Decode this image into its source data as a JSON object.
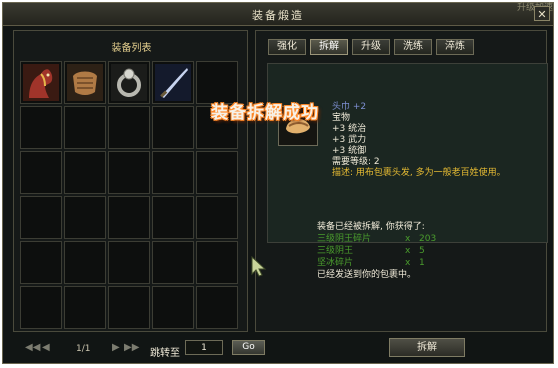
{
  "window": {
    "title": "装备煅造",
    "corner_text": "升级加速",
    "close_label": "✕"
  },
  "left_panel": {
    "header": "装备列表"
  },
  "inventory": [
    {
      "icon": "horse-icon"
    },
    {
      "icon": "armor-icon"
    },
    {
      "icon": "ring-icon"
    },
    {
      "icon": "saber-icon"
    }
  ],
  "tabs": [
    {
      "label": "强化",
      "active": false
    },
    {
      "label": "拆解",
      "active": true
    },
    {
      "label": "升级",
      "active": false
    },
    {
      "label": "洗练",
      "active": false
    },
    {
      "label": "淬炼",
      "active": false
    }
  ],
  "item_info": {
    "name": "头巾 +2",
    "type": "宝物",
    "stat1": "+3 统治",
    "stat2": "+3 武力",
    "stat3": "+3 统御",
    "level_req": "需要等级: 2",
    "description": "描述: 用布包裹头发, 多为一般老百姓使用。"
  },
  "banner": "装备拆解成功",
  "result": {
    "header": "装备已经被拆解, 你获得了:",
    "items": [
      {
        "name": "三级阴王碎片",
        "qty": "203"
      },
      {
        "name": "三级阴王",
        "qty": "5"
      },
      {
        "name": "坚冰碎片",
        "qty": "1"
      }
    ],
    "footer": "已经发送到你的包裹中。"
  },
  "pagination": {
    "first": "◀◀",
    "prev": "◀",
    "page": "1/1",
    "next": "▶",
    "last": "▶▶",
    "jump_label": "跳转至",
    "jump_value": "1",
    "go_label": "Go"
  },
  "action": {
    "dismantle_label": "拆解"
  },
  "colors": {
    "gold": "#e6bb33",
    "green": "#4a9c2d",
    "blue": "#7d8fd1",
    "banner_glow": "#ff8a2a"
  }
}
